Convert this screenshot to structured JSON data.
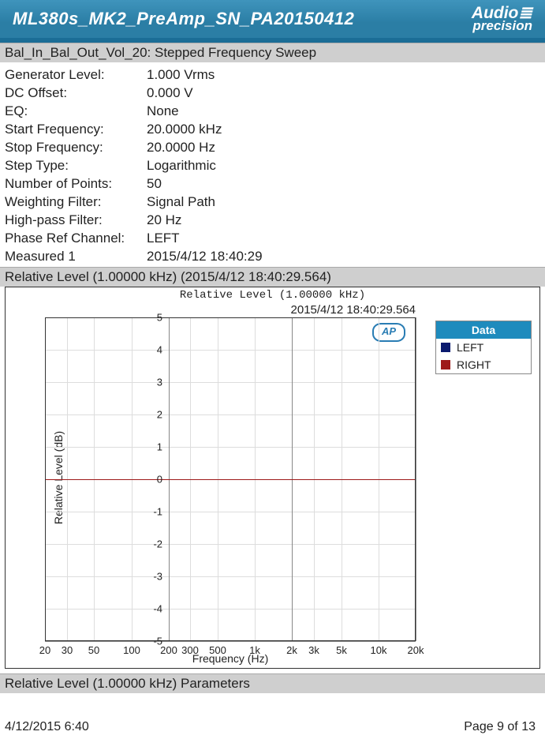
{
  "header": {
    "title": "ML380s_MK2_PreAmp_SN_PA20150412",
    "logo_line1": "Audio≣",
    "logo_line2": "precision"
  },
  "section1": {
    "prefix": "Bal_In_Bal_Out_Vol_20",
    "suffix": ": Stepped Frequency Sweep"
  },
  "params": {
    "generator_level_label": "Generator Level:",
    "generator_level_value": "1.000 Vrms",
    "dc_offset_label": "DC Offset:",
    "dc_offset_value": "0.000 V",
    "eq_label": "EQ:",
    "eq_value": "None",
    "start_freq_label": "Start Frequency:",
    "start_freq_value": "20.0000 kHz",
    "stop_freq_label": "Stop Frequency:",
    "stop_freq_value": "20.0000 Hz",
    "step_type_label": "Step Type:",
    "step_type_value": "Logarithmic",
    "num_points_label": "Number of Points:",
    "num_points_value": "50",
    "weighting_label": "Weighting Filter:",
    "weighting_value": "Signal Path",
    "hp_filter_label": "High-pass Filter:",
    "hp_filter_value": "20 Hz",
    "phase_ref_label": "Phase Ref Channel:",
    "phase_ref_value": "LEFT",
    "measured_label": "Measured 1",
    "measured_value": "2015/4/12 18:40:29"
  },
  "chart_header": "Relative Level (1.00000 kHz) (2015/4/12 18:40:29.564)",
  "chart": {
    "inner_title": "Relative Level (1.00000 kHz)",
    "timestamp": "2015/4/12 18:40:29.564",
    "badge": "AP",
    "ylabel": "Relative Level (dB)",
    "xlabel": "Frequency (Hz)",
    "yticks": [
      "5",
      "4",
      "3",
      "2",
      "1",
      "0",
      "-1",
      "-2",
      "-3",
      "-4",
      "-5"
    ],
    "xticks": [
      "20",
      "30",
      "50",
      "100",
      "200",
      "300",
      "500",
      "1k",
      "2k",
      "3k",
      "5k",
      "10k",
      "20k"
    ],
    "legend": {
      "title": "Data",
      "left": "LEFT",
      "right": "RIGHT"
    }
  },
  "chart_footer": "Relative Level (1.00000 kHz) Parameters",
  "footer": {
    "left": "4/12/2015 6:40",
    "right": "Page 9 of 13"
  },
  "chart_data": {
    "type": "line",
    "title": "Relative Level (1.00000 kHz)",
    "xlabel": "Frequency (Hz)",
    "ylabel": "Relative Level (dB)",
    "x_scale": "log",
    "xlim": [
      20,
      20000
    ],
    "ylim": [
      -5,
      5
    ],
    "x": [
      20,
      30,
      50,
      100,
      200,
      300,
      500,
      1000,
      2000,
      3000,
      5000,
      10000,
      20000
    ],
    "series": [
      {
        "name": "LEFT",
        "color": "#0a1a6e",
        "values": [
          0,
          0,
          0,
          0,
          0,
          0,
          0,
          0,
          0,
          0,
          0,
          0,
          0
        ]
      },
      {
        "name": "RIGHT",
        "color": "#9e1a1a",
        "values": [
          0,
          0,
          0,
          0,
          0,
          0,
          0,
          0,
          0,
          0,
          0,
          0,
          0
        ]
      }
    ]
  }
}
